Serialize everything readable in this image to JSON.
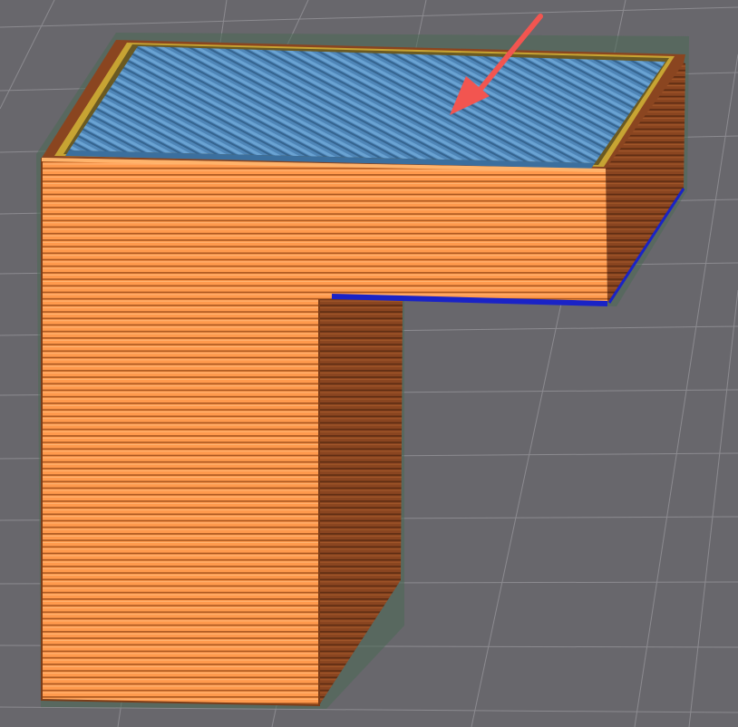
{
  "viewport": {
    "background": "#68676c",
    "grid_color": "#8c8b90"
  },
  "model": {
    "outer_wall_color": "#ff9a4d",
    "outer_wall_dark_color": "#8a4520",
    "top_skin_color": "#4f86b8",
    "top_skin_highlight_color": "#6aa3d3",
    "inner_wall_color": "#c7a433",
    "overhang_edge_color": "#1a23c6",
    "shadow_color": "#4a6a55"
  },
  "annotation": {
    "arrow_color": "#f25550",
    "arrow_icon": "arrow-down-left-icon"
  }
}
